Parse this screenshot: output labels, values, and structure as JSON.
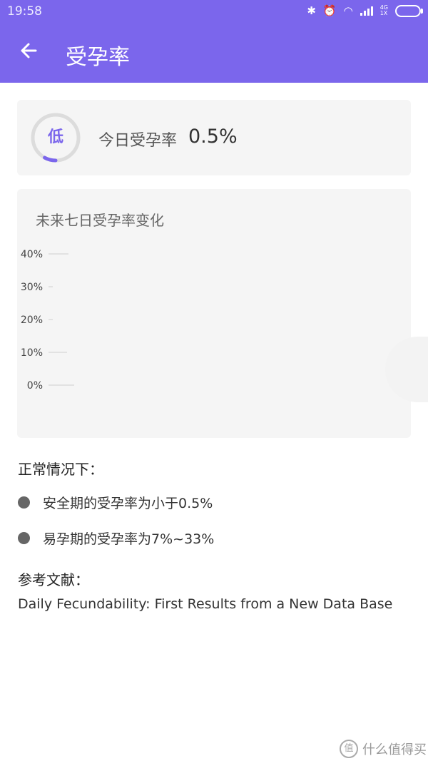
{
  "status_bar": {
    "time": "19:58",
    "network_label_top": "4G",
    "network_label_bottom": "1X"
  },
  "header": {
    "title": "受孕率",
    "back_icon": "arrow-left-icon"
  },
  "today": {
    "level_label": "低",
    "label": "今日受孕率",
    "value": "0.5%",
    "ring_fraction": 0.08,
    "ring_color": "#7b66ec"
  },
  "chart_card": {
    "title": "未来七日受孕率变化"
  },
  "chart_data": {
    "type": "line",
    "title": "未来七日受孕率变化",
    "y_ticks": [
      "40%",
      "30%",
      "20%",
      "10%",
      "0%"
    ],
    "ylim": [
      0,
      40
    ],
    "grid": false,
    "series": []
  },
  "info": {
    "heading": "正常情况下：",
    "items": [
      "安全期的受孕率为小于0.5%",
      "易孕期的受孕率为7%~33%"
    ]
  },
  "references": {
    "heading": "参考文献：",
    "text": "Daily Fecundability: First Results from a New Data Base"
  },
  "watermark": {
    "text": "什么值得买",
    "icon_text": "值"
  },
  "colors": {
    "accent": "#7b66ec",
    "card_bg": "#f5f5f5"
  }
}
